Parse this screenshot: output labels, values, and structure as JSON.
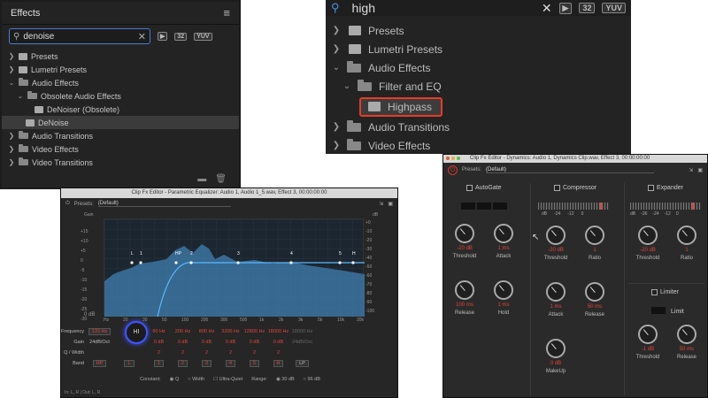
{
  "effects_panel": {
    "title": "Effects",
    "search_value": "denoise",
    "badges": [
      "32",
      "YUV"
    ],
    "tree": [
      {
        "label": "Presets",
        "level": 0,
        "expanded": false,
        "type": "folder"
      },
      {
        "label": "Lumetri Presets",
        "level": 0,
        "expanded": false,
        "type": "folder"
      },
      {
        "label": "Audio Effects",
        "level": 0,
        "expanded": true,
        "type": "folder"
      },
      {
        "label": "Obsolete Audio Effects",
        "level": 1,
        "expanded": true,
        "type": "folder"
      },
      {
        "label": "DeNoiser (Obsolete)",
        "level": 2,
        "type": "effect"
      },
      {
        "label": "DeNoise",
        "level": 1,
        "type": "effect",
        "selected": true
      },
      {
        "label": "Audio Transitions",
        "level": 0,
        "expanded": false,
        "type": "folder"
      },
      {
        "label": "Video Effects",
        "level": 0,
        "expanded": false,
        "type": "folder"
      },
      {
        "label": "Video Transitions",
        "level": 0,
        "expanded": false,
        "type": "folder"
      }
    ]
  },
  "zoom_panel": {
    "search_value": "high",
    "badges": [
      "32",
      "YUV"
    ],
    "tree": [
      {
        "label": "Presets",
        "level": 0,
        "expanded": false,
        "type": "folder"
      },
      {
        "label": "Lumetri Presets",
        "level": 0,
        "expanded": false,
        "type": "folder"
      },
      {
        "label": "Audio Effects",
        "level": 0,
        "expanded": true,
        "type": "folder"
      },
      {
        "label": "Filter and EQ",
        "level": 1,
        "expanded": true,
        "type": "folder"
      },
      {
        "label": "Highpass",
        "level": 2,
        "type": "effect",
        "highlighted": true
      },
      {
        "label": "Audio Transitions",
        "level": 0,
        "expanded": false,
        "type": "folder"
      },
      {
        "label": "Video Effects",
        "level": 0,
        "expanded": false,
        "type": "folder"
      }
    ],
    "highlight_color": "#e83a26"
  },
  "eq_panel": {
    "title": "Clip Fx Editor - Parametric Equalizer: Audio 1, Audio 1_5.wav, Effect 3, 00:00:00:00",
    "presets_label": "Presets:",
    "preset_value": "(Default)",
    "gain_label": "Gain",
    "db_label": "dB",
    "gain_ticks": [
      "+15",
      "+10",
      "+5",
      "0",
      "-5",
      "-10",
      "-15",
      "-20",
      "-25",
      "-30"
    ],
    "db_ticks": [
      "+0",
      "-10",
      "-20",
      "-30",
      "-40",
      "-50",
      "-60",
      "-70",
      "-80",
      "-90",
      "-100"
    ],
    "db_bottom": "0 dB",
    "freq_ticks": [
      "Hz",
      "20",
      "30",
      "50",
      "100",
      "200",
      "300",
      "500",
      "1k",
      "2k",
      "3k",
      "5k",
      "10k",
      "20k"
    ],
    "curve_markers": [
      "L",
      "1",
      "HP",
      "2",
      "3",
      "4",
      "5",
      "H"
    ],
    "row_labels": {
      "frequency": "Frequency",
      "gain": "Gain",
      "q": "Q / Width",
      "band": "Band"
    },
    "freq_values": [
      "133 Hz",
      "60 Hz",
      "200 Hz",
      "800 Hz",
      "3200 Hz",
      "12800 Hz",
      "18000 Hz",
      "18000 Hz"
    ],
    "hp_slope": "24dB/Oct",
    "lp_slope": "24dB/Oct",
    "gain_values": [
      "0 dB",
      "0 dB",
      "0 dB",
      "0 dB",
      "0 dB",
      "0 dB"
    ],
    "q_values": [
      "2",
      "2",
      "2",
      "2",
      "2",
      "2"
    ],
    "bands": [
      "HP",
      "L",
      "1",
      "2",
      "3",
      "4",
      "5",
      "H",
      "LP"
    ],
    "knob_label": "HI",
    "constant_label": "Constant:",
    "constant_options": [
      "Q",
      "Width"
    ],
    "ultra_quiet": "Ultra-Quiet",
    "range_label": "Range:",
    "range_options": [
      "30 dB",
      "96 dB"
    ],
    "io_label": "In: L, R | Out: L, R",
    "curve_color": "#3f9cd6",
    "knob_color": "#3f54ff"
  },
  "dyn_panel": {
    "title": "Clip Fx Editor - Dynamics: Audio 1, Dynamics Clip.wav, Effect 3, 00:00:00:00",
    "presets_label": "Presets:",
    "preset_value": "(Default)",
    "power_icon": "power-icon",
    "sections": {
      "autogate": {
        "label": "AutoGate",
        "knobs": [
          {
            "name": "Threshold",
            "value": "-20 dB"
          },
          {
            "name": "Attack",
            "value": "1 ms"
          },
          {
            "name": "Release",
            "value": "100 ms"
          },
          {
            "name": "Hold",
            "value": "1 ms"
          }
        ]
      },
      "compressor": {
        "label": "Compressor",
        "scale": [
          "dB",
          "-24",
          "-12",
          "0"
        ],
        "knobs": [
          {
            "name": "Threshold",
            "value": "-20 dB"
          },
          {
            "name": "Ratio",
            "value": "1"
          },
          {
            "name": "Attack",
            "value": "1 ms"
          },
          {
            "name": "Release",
            "value": "50 ms"
          },
          {
            "name": "MakeUp",
            "value": "0 dB"
          }
        ]
      },
      "expander": {
        "label": "Expander",
        "scale": [
          "dB",
          "-36",
          "-24",
          "-12",
          "0"
        ],
        "knobs": [
          {
            "name": "Threshold",
            "value": "-20 dB"
          },
          {
            "name": "Ratio",
            "value": "1"
          }
        ]
      },
      "limiter": {
        "label": "Limiter",
        "limit_label": "Limit",
        "knobs": [
          {
            "name": "Threshold",
            "value": "-1 dB"
          },
          {
            "name": "Release",
            "value": "50 ms"
          }
        ]
      }
    }
  }
}
